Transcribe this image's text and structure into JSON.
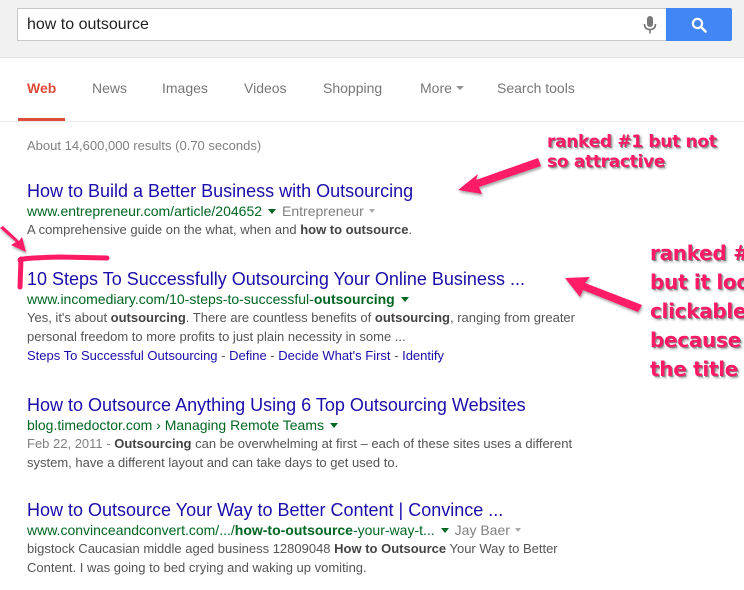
{
  "search": {
    "query": "how to outsource",
    "mic_icon": "microphone-icon",
    "search_icon": "magnifier-icon"
  },
  "tabs": [
    {
      "label": "Web",
      "active": true
    },
    {
      "label": "News"
    },
    {
      "label": "Images"
    },
    {
      "label": "Videos"
    },
    {
      "label": "Shopping"
    },
    {
      "label": "More",
      "has_dropdown": true
    },
    {
      "label": "Search tools"
    }
  ],
  "stats": "About 14,600,000 results (0.70 seconds)",
  "results": [
    {
      "title": "How to Build a Better Business with Outsourcing",
      "url": "www.entrepreneur.com/article/204652",
      "source": "Entrepreneur",
      "snippet_pre": "A comprehensive guide on the what, when and ",
      "snippet_bold": "how to outsource",
      "snippet_post": "."
    },
    {
      "title": "10 Steps To Successfully Outsourcing Your Online Business ...",
      "url_pre": "www.incomediary.com/10-steps-to-successful-",
      "url_bold": "outsourcing",
      "snippet_1": "Yes, it's about ",
      "snippet_b1": "outsourcing",
      "snippet_2": ". There are countless benefits of ",
      "snippet_b2": "outsourcing",
      "snippet_3": ", ranging from greater personal freedom to more profits to just plain necessity in some ...",
      "sitelinks": [
        "Steps To Successful Outsourcing",
        "Define",
        "Decide What's First",
        "Identify"
      ],
      "sitelink_sep": " - "
    },
    {
      "title": "How to Outsource Anything Using 6 Top Outsourcing Websites",
      "url": "blog.timedoctor.com › Managing Remote Teams",
      "date": "Feb 22, 2011 - ",
      "snippet_bold": "Outsourcing",
      "snippet_post": " can be overwhelming at first – each of these sites uses a different system, have a different layout and can take days to get used to."
    },
    {
      "title": "How to Outsource Your Way to Better Content | Convince ...",
      "url_pre": "www.convinceandconvert.com/.../",
      "url_bold": "how-to-outsource",
      "url_post": "-your-way-t...",
      "source": "Jay Baer",
      "snippet_pre": "bigstock Caucasian middle aged business 12809048 ",
      "snippet_bold": "How to Outsource",
      "snippet_post": " Your Way to Better Content. I was going to bed crying and waking up vomiting."
    }
  ],
  "annotations": {
    "note1": [
      "ranked #1 but not",
      "so attractive"
    ],
    "note2": [
      "ranked #",
      "but it loo",
      "clickable",
      "because",
      "the title"
    ],
    "color": "#ff1a66"
  },
  "colors": {
    "link": "#1a0dab",
    "url": "#006621",
    "snippet": "#545454",
    "accent_red": "#dd4b39",
    "search_blue": "#4285f4"
  }
}
